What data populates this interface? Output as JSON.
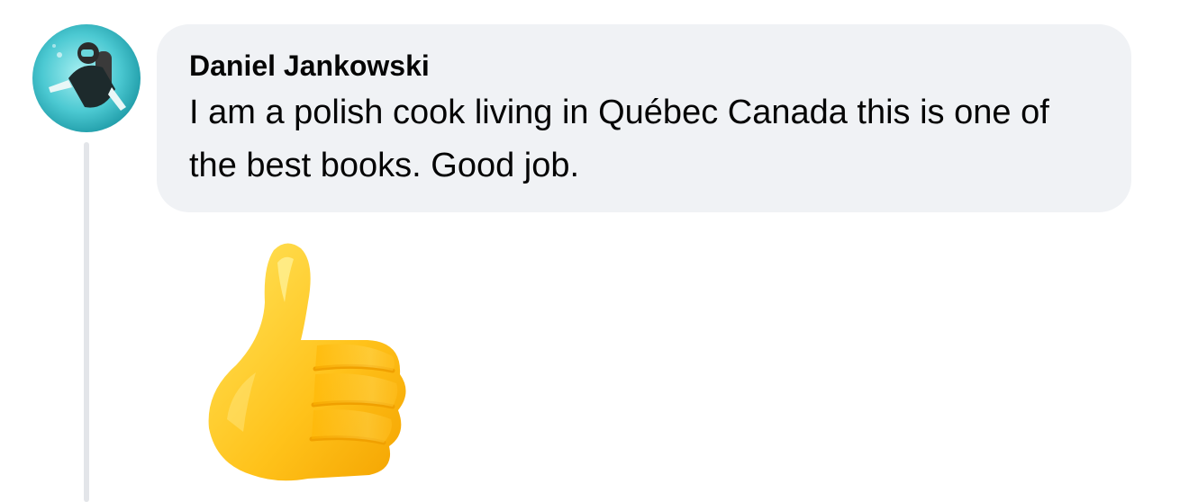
{
  "comment": {
    "author": "Daniel Jankowski",
    "text": "I am a polish cook living in Québec Canada this is one of the best books. Good job."
  },
  "avatar": {
    "icon": "profile-photo-diver",
    "colors": {
      "water_light": "#7fe0e6",
      "water_dark": "#1aa6b3"
    }
  },
  "sticker": {
    "icon": "thumbs-up-icon",
    "colors": {
      "highlight": "#ffe45c",
      "base": "#ffb500",
      "shade": "#f09a00"
    }
  },
  "theme": {
    "bubble_background": "#f0f2f5",
    "thread_line": "#e3e5e9",
    "text": "#050505"
  }
}
